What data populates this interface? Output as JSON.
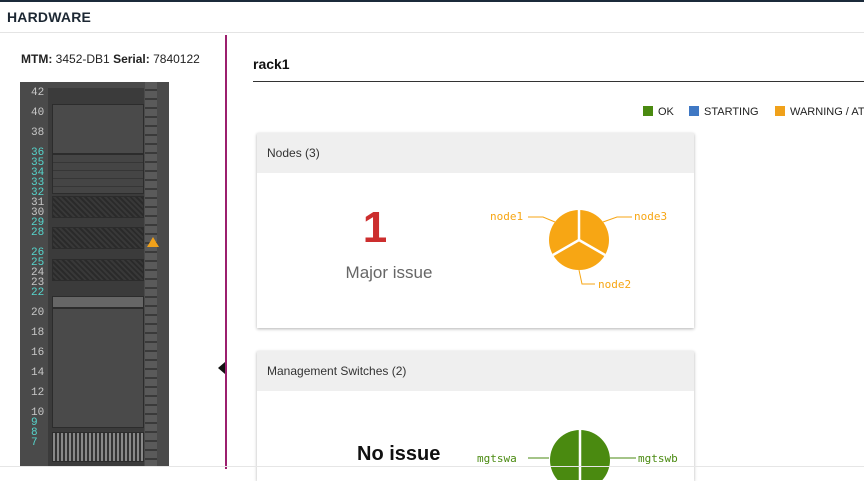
{
  "header": {
    "title": "HARDWARE"
  },
  "system": {
    "mtm_label": "MTM:",
    "mtm_value": "3452-DB1",
    "serial_label": "Serial:",
    "serial_value": "7840122"
  },
  "rack": {
    "units": [
      "42",
      "40",
      "38",
      "36",
      "35",
      "34",
      "33",
      "32",
      "31",
      "30",
      "29",
      "28",
      "26",
      "25",
      "24",
      "23",
      "22",
      "20",
      "18",
      "16",
      "14",
      "12",
      "10",
      "9",
      "8",
      "7"
    ],
    "highlighted_units": [
      "36",
      "35",
      "34",
      "33",
      "32",
      "29",
      "28",
      "26",
      "25",
      "22",
      "9",
      "8",
      "7"
    ],
    "warning_unit": "28"
  },
  "main": {
    "rack_title": "rack1",
    "legend": [
      {
        "label": "OK",
        "color": "#4a8a10"
      },
      {
        "label": "STARTING",
        "color": "#3f78c4"
      },
      {
        "label": "WARNING / AT",
        "color": "#f0a11a"
      }
    ],
    "cards": [
      {
        "title": "Nodes (3)",
        "issue_count": "1",
        "issue_label": "Major issue",
        "pie_color": "#f7a614",
        "pie_labels": [
          "node1",
          "node3",
          "node2"
        ]
      },
      {
        "title": "Management Switches (2)",
        "issue_label": "No issue",
        "pie_color": "#4a8a10",
        "pie_labels": [
          "mgtswa",
          "mgtswb"
        ]
      }
    ]
  }
}
